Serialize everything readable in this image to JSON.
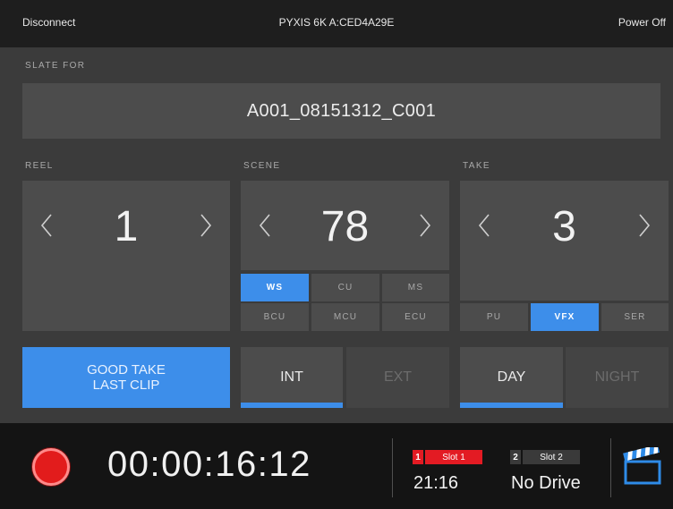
{
  "topbar": {
    "disconnect": "Disconnect",
    "device": "PYXIS 6K A:CED4A29E",
    "power_off": "Power Off"
  },
  "slate": {
    "label": "SLATE FOR",
    "clip_name": "A001_08151312_C001"
  },
  "reel": {
    "label": "REEL",
    "value": "1"
  },
  "scene": {
    "label": "SCENE",
    "value": "78",
    "shot_types": [
      "WS",
      "CU",
      "MS",
      "BCU",
      "MCU",
      "ECU"
    ],
    "selected": "WS"
  },
  "take": {
    "label": "TAKE",
    "value": "3",
    "types": [
      "PU",
      "VFX",
      "SER"
    ],
    "selected": "VFX"
  },
  "good_take": {
    "line1": "GOOD TAKE",
    "line2": "LAST CLIP"
  },
  "int_ext": {
    "int": "INT",
    "ext": "EXT",
    "selected": "INT"
  },
  "day_night": {
    "day": "DAY",
    "night": "NIGHT",
    "selected": "DAY"
  },
  "status": {
    "timecode": "00:00:16:12",
    "slot1": {
      "number": "1",
      "label": "Slot 1",
      "value": "21:16"
    },
    "slot2": {
      "number": "2",
      "label": "Slot 2",
      "value": "No Drive"
    }
  },
  "colors": {
    "accent": "#3d8eea",
    "record": "#e21c1c",
    "slot_active": "#e31b23",
    "slot_inactive": "#3a3a3a"
  },
  "icons": {
    "left": "chevron-left-icon",
    "right": "chevron-right-icon",
    "record": "record-icon",
    "clapper": "clapperboard-icon"
  }
}
